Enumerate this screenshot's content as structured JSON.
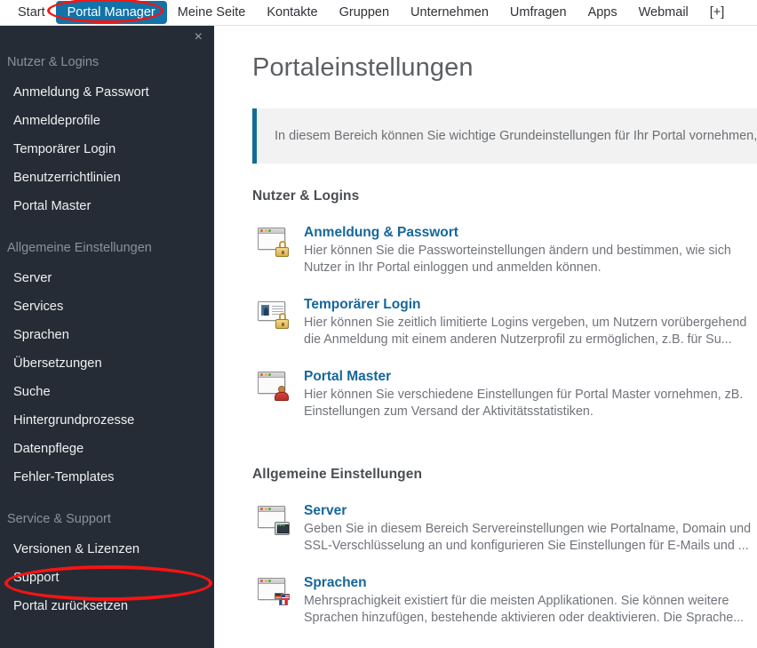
{
  "topnav": {
    "items": [
      {
        "label": "Start",
        "active": false
      },
      {
        "label": "Portal Manager",
        "active": true
      },
      {
        "label": "Meine Seite",
        "active": false
      },
      {
        "label": "Kontakte",
        "active": false
      },
      {
        "label": "Gruppen",
        "active": false
      },
      {
        "label": "Unternehmen",
        "active": false
      },
      {
        "label": "Umfragen",
        "active": false
      },
      {
        "label": "Apps",
        "active": false
      },
      {
        "label": "Webmail",
        "active": false
      },
      {
        "label": "[+]",
        "active": false
      }
    ],
    "active_color": "#1173a8"
  },
  "annotations": {
    "color": "#f61414",
    "tab_highlight": "Portal Manager",
    "sidebar_highlight": "Portal zurücksetzen"
  },
  "sidebar": {
    "close_icon": "×",
    "background": "#262c35",
    "groups": [
      {
        "title": "Nutzer & Logins",
        "items": [
          "Anmeldung & Passwort",
          "Anmeldeprofile",
          "Temporärer Login",
          "Benutzerrichtlinien",
          "Portal Master"
        ]
      },
      {
        "title": "Allgemeine Einstellungen",
        "items": [
          "Server",
          "Services",
          "Sprachen",
          "Übersetzungen",
          "Suche",
          "Hintergrundprozesse",
          "Datenpflege",
          "Fehler-Templates"
        ]
      },
      {
        "title": "Service & Support",
        "items": [
          "Versionen & Lizenzen",
          "Support",
          "Portal zurücksetzen"
        ]
      }
    ]
  },
  "main": {
    "title": "Portaleinstellungen",
    "banner": {
      "text": "In diesem Bereich können Sie wichtige Grundeinstellungen für Ihr Portal vornehmen,",
      "accent_color": "#136c94",
      "background": "#f2f2f2"
    },
    "sections": [
      {
        "heading": "Nutzer & Logins",
        "entries": [
          {
            "icon": "window-lock-icon",
            "title": "Anmeldung & Passwort",
            "desc": "Hier können Sie die Passworteinstellungen ändern und bestimmen, wie sich Nutzer in Ihr Portal einloggen und anmelden können."
          },
          {
            "icon": "idcard-lock-icon",
            "title": "Temporärer Login",
            "desc": "Hier können Sie zeitlich limitierte Logins vergeben, um Nutzern vorübergehend die Anmeldung mit einem anderen Nutzerprofil zu ermöglichen, z.B. für Su..."
          },
          {
            "icon": "window-person-icon",
            "title": "Portal Master",
            "desc": "Hier können Sie verschiedene Einstellungen für Portal Master vornehmen, zB. Einstellungen zum Versand der Aktivitätsstatistiken."
          }
        ]
      },
      {
        "heading": "Allgemeine Einstellungen",
        "entries": [
          {
            "icon": "window-monitor-icon",
            "title": "Server",
            "desc": "Geben Sie in diesem Bereich Servereinstellungen wie Portalname, Domain und SSL-Verschlüsselung an und konfigurieren Sie Einstellungen für E-Mails und ..."
          },
          {
            "icon": "window-flags-icon",
            "title": "Sprachen",
            "desc": "Mehrsprachigkeit existiert für die meisten Applikationen. Sie können weitere Sprachen hinzufügen, bestehende aktivieren oder deaktivieren. Die Sprache..."
          }
        ]
      }
    ],
    "link_color": "#15679b"
  }
}
